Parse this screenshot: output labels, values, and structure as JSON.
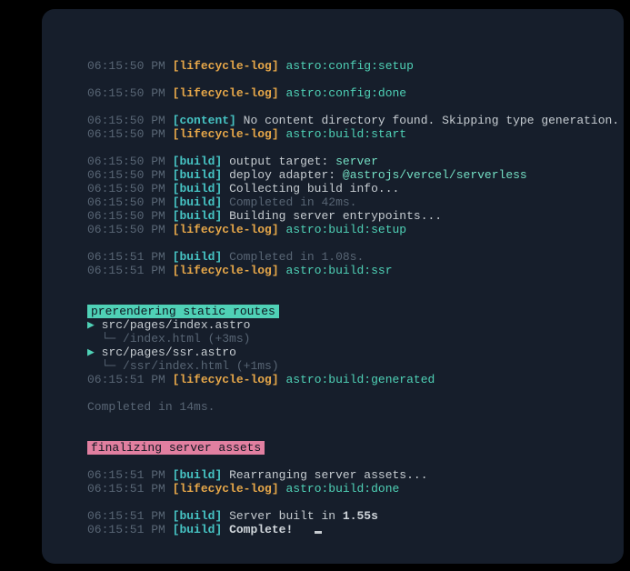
{
  "colors": {
    "background": "#161e2b",
    "timestamp": "#586574",
    "lifecycle": "#e6a749",
    "tag": "#46c3c3",
    "hook": "#4fd1b6",
    "message": "#c6ccd1",
    "dim": "#586574",
    "value": "#74dfc4",
    "banner_green": "#4fd1b6",
    "banner_pink": "#e17fa0"
  },
  "ts": {
    "a": "06:15:50 PM",
    "b": "06:15:51 PM"
  },
  "tags": {
    "lc": "[lifecycle-log]",
    "build": "[build]",
    "content": "[content]"
  },
  "hooks": {
    "config_setup": "astro:config:setup",
    "config_done": "astro:config:done",
    "build_start": "astro:build:start",
    "build_setup": "astro:build:setup",
    "build_ssr": "astro:build:ssr",
    "build_generated": "astro:build:generated",
    "build_done": "astro:build:done"
  },
  "lines": {
    "no_content": "No content directory found. Skipping type generation.",
    "output_target_label": "output target: ",
    "output_target_value": "server",
    "deploy_adapter_label": "deploy adapter: ",
    "deploy_adapter_value": "@astrojs/vercel/serverless",
    "collecting": "Collecting build info...",
    "completed_42": "Completed in 42ms.",
    "building_entry": "Building server entrypoints...",
    "completed_108": "Completed in 1.08s.",
    "completed_14": "Completed in 14ms.",
    "rearranging": "Rearranging server assets...",
    "server_built_prefix": "Server built in ",
    "server_built_time": "1.55s",
    "complete": "Complete!"
  },
  "banners": {
    "prerender": " prerendering static routes ",
    "finalize": " finalizing server assets "
  },
  "tree": {
    "arrow": "▶",
    "branch": "└─",
    "route1": "src/pages/index.astro",
    "out1": " /index.html ",
    "time1": "(+3ms)",
    "route2": "src/pages/ssr.astro",
    "out2": " /ssr/index.html ",
    "time2": "(+1ms)"
  }
}
